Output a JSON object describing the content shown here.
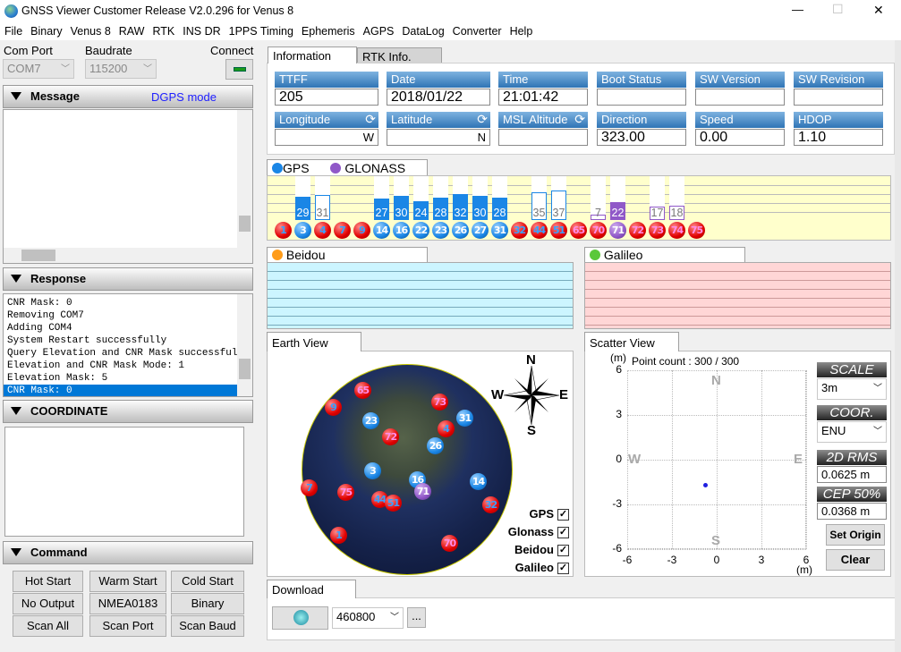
{
  "window": {
    "title": "GNSS Viewer Customer Release V2.0.296 for Venus 8",
    "min": "—",
    "max": "☐",
    "close": "✕"
  },
  "menu": [
    "File",
    "Binary",
    "Venus 8",
    "RAW",
    "RTK",
    "INS DR",
    "1PPS Timing",
    "Ephemeris",
    "AGPS",
    "DataLog",
    "Converter",
    "Help"
  ],
  "conn": {
    "com_label": "Com Port",
    "com_value": "COM7",
    "baud_label": "Baudrate",
    "baud_value": "115200",
    "connect_label": "Connect"
  },
  "message": {
    "title": "Message",
    "mode": "DGPS mode"
  },
  "response": {
    "title": "Response",
    "lines": [
      "CNR Mask: 0",
      "Removing COM7",
      "Adding COM4",
      "System Restart successfully",
      "Query Elevation and CNR Mask successful",
      "Elevation and CNR Mask Mode: 1",
      "Elevation Mask: 5",
      "CNR Mask: 0"
    ],
    "selected_index": 7
  },
  "coordinate": {
    "title": "COORDINATE"
  },
  "command": {
    "title": "Command",
    "buttons": [
      "Hot Start",
      "Warm Start",
      "Cold Start",
      "No Output",
      "NMEA0183",
      "Binary",
      "Scan All",
      "Scan Port",
      "Scan Baud"
    ]
  },
  "tabs": {
    "info": "Information",
    "rtk": "RTK Info."
  },
  "info": {
    "row1": [
      {
        "label": "TTFF",
        "value": "205"
      },
      {
        "label": "Date",
        "value": "2018/01/22"
      },
      {
        "label": "Time",
        "value": "21:01:42"
      },
      {
        "label": "Boot Status",
        "value": ""
      },
      {
        "label": "SW  Version",
        "value": ""
      },
      {
        "label": "SW  Revision",
        "value": ""
      }
    ],
    "row2": [
      {
        "label": "Longitude",
        "value": "W"
      },
      {
        "label": "Latitude",
        "value": "N"
      },
      {
        "label": "MSL Altitude",
        "value": ""
      },
      {
        "label": "Direction",
        "value": "323.00"
      },
      {
        "label": "Speed",
        "value": "0.00"
      },
      {
        "label": "HDOP",
        "value": "1.10"
      }
    ]
  },
  "sat_tabs": {
    "gps": "GPS",
    "glonass": "GLONASS",
    "beidou": "Beidou",
    "galileo": "Galileo"
  },
  "colors": {
    "gps": "#1a86e6",
    "glonass": "#9058c8",
    "unused": "#e00000",
    "chart_bg": "#ffffcc",
    "beidou_bg": "#ccf5ff",
    "galileo_bg": "#ffd6d6"
  },
  "satellites": [
    {
      "prn": "1",
      "sys": "gps",
      "used": false
    },
    {
      "prn": "3",
      "sys": "gps",
      "used": true,
      "snr": 29
    },
    {
      "prn": "4",
      "sys": "gps",
      "used": false,
      "snr": 31
    },
    {
      "prn": "7",
      "sys": "gps",
      "used": false
    },
    {
      "prn": "9",
      "sys": "gps",
      "used": false
    },
    {
      "prn": "14",
      "sys": "gps",
      "used": true,
      "snr": 27
    },
    {
      "prn": "16",
      "sys": "gps",
      "used": true,
      "snr": 30
    },
    {
      "prn": "22",
      "sys": "gps",
      "used": true,
      "snr": 24
    },
    {
      "prn": "23",
      "sys": "gps",
      "used": true,
      "snr": 28
    },
    {
      "prn": "26",
      "sys": "gps",
      "used": true,
      "snr": 32
    },
    {
      "prn": "27",
      "sys": "gps",
      "used": true,
      "snr": 30
    },
    {
      "prn": "31",
      "sys": "gps",
      "used": true,
      "snr": 28
    },
    {
      "prn": "32",
      "sys": "gps",
      "used": false
    },
    {
      "prn": "44",
      "sys": "gps",
      "used": false,
      "snr": 35
    },
    {
      "prn": "51",
      "sys": "gps",
      "used": false,
      "snr": 37
    },
    {
      "prn": "65",
      "sys": "glonass",
      "used": false
    },
    {
      "prn": "70",
      "sys": "glonass",
      "used": false,
      "snr": 7
    },
    {
      "prn": "71",
      "sys": "glonass",
      "used": true,
      "snr": 22
    },
    {
      "prn": "72",
      "sys": "glonass",
      "used": false
    },
    {
      "prn": "73",
      "sys": "glonass",
      "used": false,
      "snr": 17
    },
    {
      "prn": "74",
      "sys": "glonass",
      "used": false,
      "snr": 18
    },
    {
      "prn": "75",
      "sys": "glonass",
      "used": false
    }
  ],
  "earth": {
    "title": "Earth View",
    "compass": {
      "n": "N",
      "s": "S",
      "e": "E",
      "w": "W"
    },
    "sats": [
      {
        "prn": "65",
        "c": "r",
        "t": "tk"
      },
      {
        "prn": "9",
        "c": "r",
        "t": "tg"
      },
      {
        "prn": "73",
        "c": "r",
        "t": "tk"
      },
      {
        "prn": "31",
        "c": "b"
      },
      {
        "prn": "23",
        "c": "b"
      },
      {
        "prn": "4",
        "c": "r",
        "t": "tg"
      },
      {
        "prn": "72",
        "c": "r",
        "t": "tk"
      },
      {
        "prn": "26",
        "c": "b"
      },
      {
        "prn": "3",
        "c": "b"
      },
      {
        "prn": "16",
        "c": "b"
      },
      {
        "prn": "71",
        "c": "p"
      },
      {
        "prn": "14",
        "c": "b"
      },
      {
        "prn": "7",
        "c": "r",
        "t": "tg"
      },
      {
        "prn": "75",
        "c": "r",
        "t": "tk"
      },
      {
        "prn": "44",
        "c": "r",
        "t": "tg"
      },
      {
        "prn": "51",
        "c": "r",
        "t": "tg"
      },
      {
        "prn": "32",
        "c": "r",
        "t": "tg"
      },
      {
        "prn": "1",
        "c": "r",
        "t": "tg"
      },
      {
        "prn": "70",
        "c": "r",
        "t": "tk"
      }
    ],
    "filters": [
      {
        "label": "GPS",
        "checked": true
      },
      {
        "label": "Glonass",
        "checked": true
      },
      {
        "label": "Beidou",
        "checked": true
      },
      {
        "label": "Galileo",
        "checked": true
      }
    ]
  },
  "scatter": {
    "title": "Scatter View",
    "unit": "(m)",
    "point_count": "Point count : 300 / 300",
    "ticks": [
      "-6",
      "-3",
      "0",
      "3",
      "6"
    ],
    "dirs": {
      "n": "N",
      "s": "S",
      "e": "E",
      "w": "W"
    },
    "points": [
      {
        "e": -0.8,
        "n": -1.7
      }
    ],
    "scale_label": "SCALE",
    "scale_value": "3m",
    "coor_label": "COOR.",
    "coor_value": "ENU",
    "rms_label": "2D RMS",
    "rms_value": "0.0625 m",
    "cep_label": "CEP 50%",
    "cep_value": "0.0368 m",
    "set_origin": "Set Origin",
    "clear": "Clear"
  },
  "download": {
    "title": "Download",
    "baud": "460800",
    "browse": "..."
  }
}
